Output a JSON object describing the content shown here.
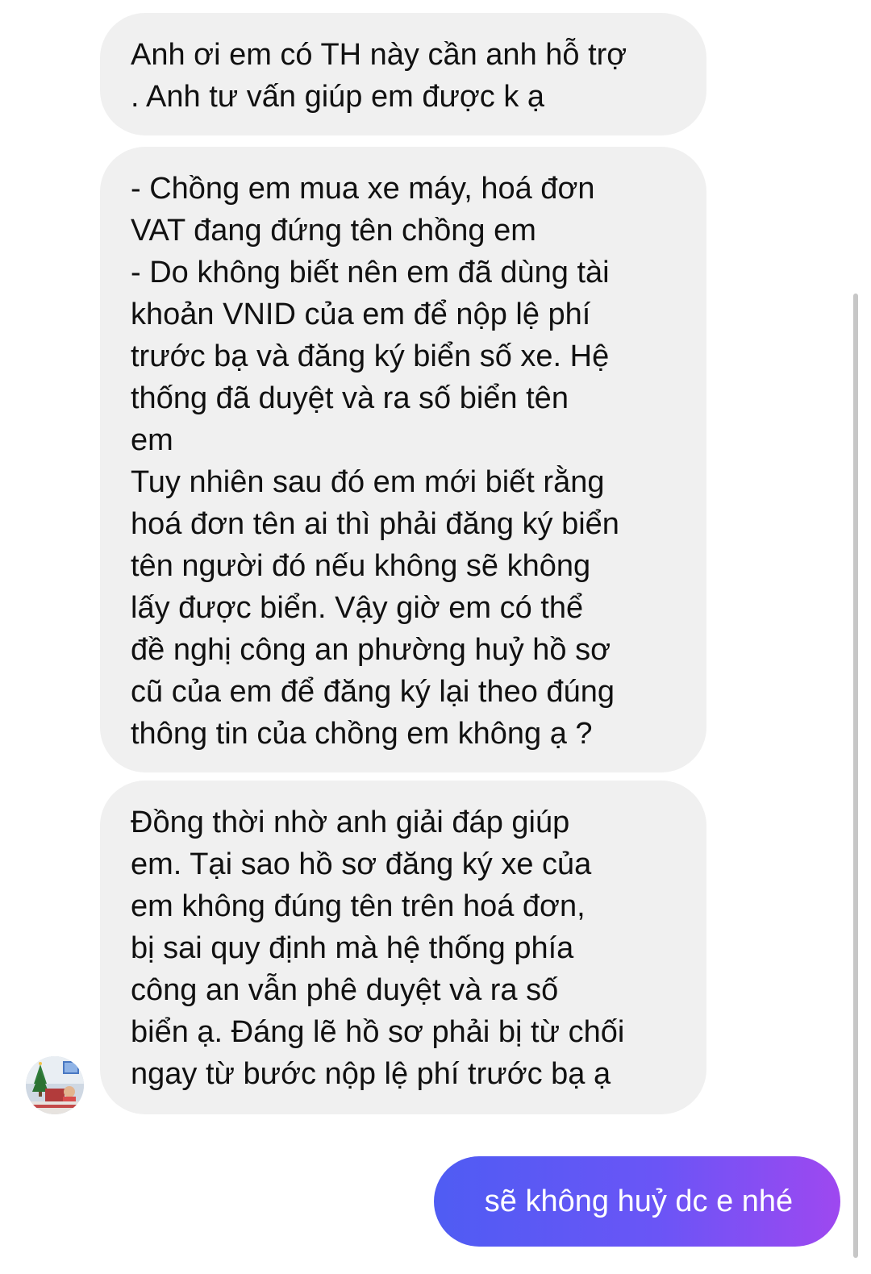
{
  "conversation": {
    "incoming_messages": [
      {
        "text": "Anh ơi em có TH này cần anh hỗ trợ\n. Anh tư vấn giúp em được k ạ"
      },
      {
        "text": "- Chồng em mua xe máy, hoá đơn\nVAT đang đứng tên chồng em\n- Do không biết nên em đã dùng tài\nkhoản VNID của em để nộp lệ phí\ntrước bạ và đăng ký biển số xe. Hệ\nthống đã duyệt và ra số biển tên\nem\nTuy nhiên sau đó em mới biết rằng\nhoá đơn tên ai thì phải đăng ký biển\ntên người đó nếu không sẽ không\nlấy được biển.  Vậy giờ em có thể\nđề nghị công an phường huỷ hồ sơ\ncũ của em để đăng ký lại theo đúng\nthông tin của chồng em không ạ ?"
      },
      {
        "text": "Đồng thời nhờ anh  giải đáp giúp\nem. Tại sao hồ sơ đăng ký xe của\nem không đúng tên trên hoá đơn,\nbị sai quy định mà hệ thống phía\ncông an vẫn phê duyệt và ra số\nbiển ạ. Đáng lẽ hồ sơ phải bị từ chối\nngay từ bước nộp lệ phí trước bạ ạ"
      }
    ],
    "outgoing_messages": [
      {
        "text": "sẽ không huỷ dc e nhé"
      }
    ],
    "sender_avatar": "sender-avatar",
    "colors": {
      "incoming_bubble": "#f0f0f0",
      "outgoing_gradient_start": "#4f5cf3",
      "outgoing_gradient_end": "#9e48f0",
      "scrollbar": "#c7c7c7"
    }
  }
}
